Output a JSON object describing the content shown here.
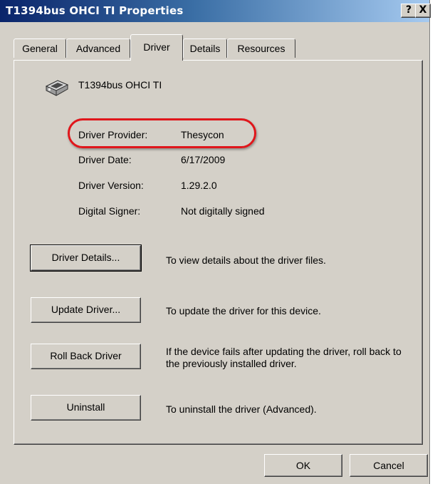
{
  "window": {
    "title": "T1394bus OHCI TI Properties",
    "help_glyph": "?",
    "close_glyph": "X"
  },
  "tabs": [
    {
      "label": "General",
      "active": false
    },
    {
      "label": "Advanced",
      "active": false
    },
    {
      "label": "Driver",
      "active": true
    },
    {
      "label": "Details",
      "active": false
    },
    {
      "label": "Resources",
      "active": false
    }
  ],
  "device": {
    "icon": "pci-card-icon",
    "name": "T1394bus OHCI TI"
  },
  "driver_info": [
    {
      "label": "Driver Provider:",
      "value": "Thesycon",
      "highlighted": true
    },
    {
      "label": "Driver Date:",
      "value": "6/17/2009"
    },
    {
      "label": "Driver Version:",
      "value": "1.29.2.0"
    },
    {
      "label": "Digital Signer:",
      "value": "Not digitally signed"
    }
  ],
  "actions": [
    {
      "button": "Driver Details...",
      "description": "To view details about the driver files."
    },
    {
      "button": "Update Driver...",
      "description": "To update the driver for this device."
    },
    {
      "button": "Roll Back Driver",
      "description": "If the device fails after updating the driver, roll back to the previously installed driver."
    },
    {
      "button": "Uninstall",
      "description": "To uninstall the driver (Advanced)."
    }
  ],
  "footer": {
    "ok": "OK",
    "cancel": "Cancel"
  },
  "colors": {
    "dialog_face": "#d4d0c8",
    "titlebar_start": "#0a246a",
    "annotation_ring": "#e0161b"
  }
}
